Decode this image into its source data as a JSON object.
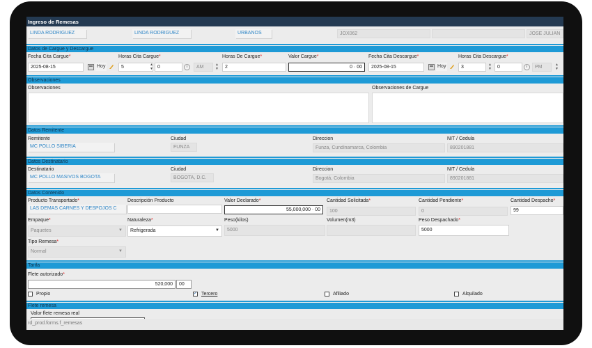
{
  "title": "Ingreso de Remesas",
  "top_row": {
    "field1": "LINDA RODRIGUEZ",
    "field2": "LINDA RODRIGUEZ",
    "field3": "URBANOS",
    "field4": "JOX062",
    "field5": "",
    "field6": "JOSE JULIAN"
  },
  "cargue": {
    "section": "Datos de Cargue y Descargue",
    "fecha_cita_label": "Fecha Cita Cargue",
    "fecha_cita_value": "2025-08-15",
    "hoy_label": "Hoy",
    "horas_cita_label": "Horas Cita Cargue",
    "horas_value": "5",
    "minutos_value": "0",
    "ampm_value": "AM",
    "horas_de_cargue_label": "Horas De Cargue",
    "horas_de_cargue_value": "2",
    "valor_cargue_label": "Valor Cargue",
    "valor_cargue_value": "0 · 00",
    "fecha_descargue_label": "Fecha Cita Descargue",
    "fecha_descargue_value": "2025-08-15",
    "horas_descargue_label": "Horas Cita Descargue",
    "horas_descargue_value": "3",
    "minutos_descargue_value": "0",
    "ampm_descargue_value": "PM"
  },
  "observaciones": {
    "section": "Observaciones",
    "label": "Observaciones",
    "cargue_label": "Observaciones de Cargue"
  },
  "remitente": {
    "section": "Datos Remitente",
    "remitente_label": "Remitente",
    "remitente_value": "MC POLLO SIBERIA",
    "ciudad_label": "Ciudad",
    "ciudad_value": "FUNZA",
    "direccion_label": "Direccion",
    "direccion_value": "Funza, Cundinamarca, Colombia",
    "nit_label": "NIT / Cedula",
    "nit_value": "890201881"
  },
  "destinatario": {
    "section": "Datos Destinatario",
    "destinatario_label": "Destinatario",
    "destinatario_value": "MC POLLO MASIVOS BOGOTA",
    "ciudad_label": "Ciudad",
    "ciudad_value": "BOGOTA, D.C.",
    "direccion_label": "Direccion",
    "direccion_value": "Bogotá, Colombia",
    "nit_label": "NIT / Cedula",
    "nit_value": "890201881"
  },
  "contenido": {
    "section": "Datos Contenido",
    "producto_label": "Producto Transportado",
    "producto_value": "LAS DEMAS CARNES Y DESPOJOS C",
    "descripcion_label": "Descripción Producto",
    "valor_declarado_label": "Valor Declarado",
    "valor_declarado_value": "55,000,000 · 00",
    "cantidad_solicitada_label": "Cantidad Solicitada",
    "cantidad_solicitada_value": "100",
    "cantidad_pendiente_label": "Cantidad Pendiente",
    "cantidad_pendiente_value": "0",
    "cantidad_despacho_label": "Cantidad Despacho",
    "cantidad_despacho_value": "99",
    "empaque_label": "Empaque",
    "empaque_value": "Paquetes",
    "naturaleza_label": "Naturaleza",
    "naturaleza_value": "Refrigerada",
    "peso_label": "Peso(kilos)",
    "peso_value": "5000",
    "volumen_label": "Volumen(m3)",
    "peso_despachado_label": "Peso Despachado",
    "peso_despachado_value": "5000",
    "tipo_remesa_label": "Tipo Remesa",
    "tipo_remesa_value": "Normal"
  },
  "tarifa": {
    "section": "Tarifa",
    "flete_label": "Flete autorizado",
    "flete_value": "520,000",
    "flete_decimals": "00",
    "propio_label": "Propio",
    "tercero_label": "Tercero",
    "afiliado_label": "Afiliado",
    "alquilado_label": "Alquilado"
  },
  "flete_remesa": {
    "section": "Flete remesa",
    "valor_real_label": "Valor flete remesa real"
  },
  "footer": "rd_prod.forms.f_remesas",
  "colors": {
    "header_bg": "#243a52",
    "section_bar": "#1e9ad6",
    "link_text": "#2f86c6",
    "required": "#e02020"
  }
}
